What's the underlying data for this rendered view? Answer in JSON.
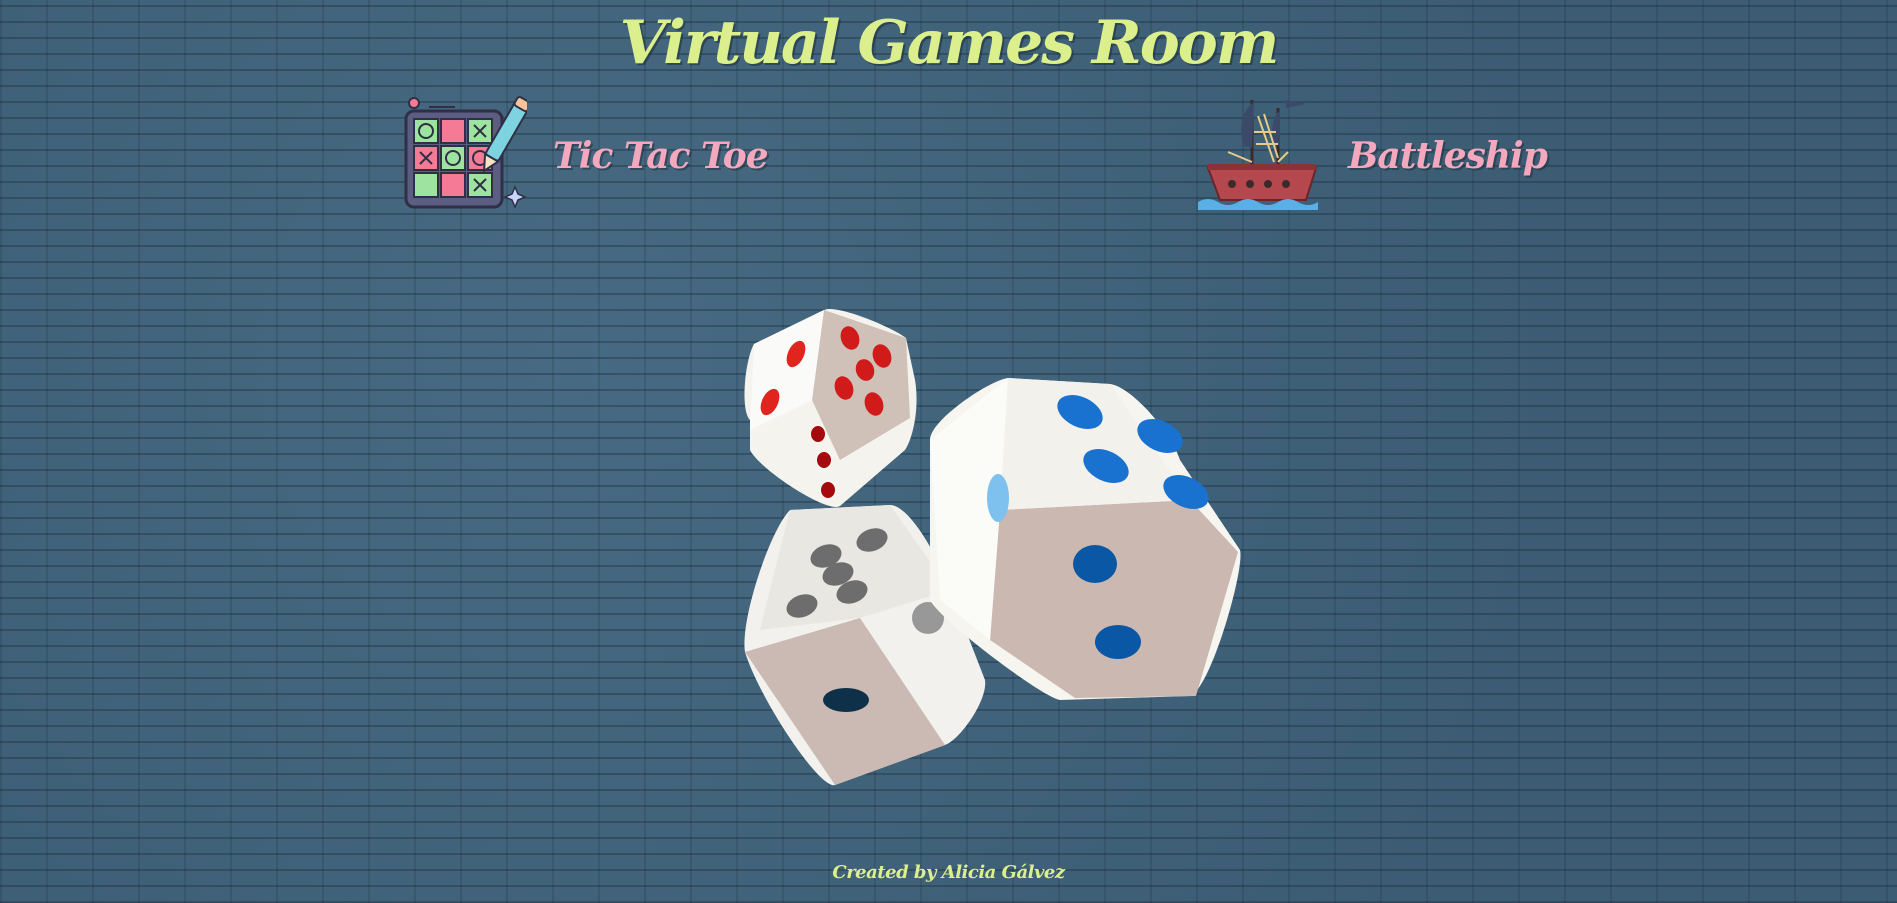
{
  "header": {
    "title": "Virtual Games Room"
  },
  "games": [
    {
      "label": "Tic Tac Toe",
      "icon": "tic-tac-toe-board-icon"
    },
    {
      "label": "Battleship",
      "icon": "pirate-ship-icon"
    }
  ],
  "hero": {
    "icon": "dice-icon"
  },
  "footer": {
    "credit": "Created by Alicia Gálvez"
  },
  "colors": {
    "background": "#3f6178",
    "title": "#dbf08c",
    "game_label": "#f4a8bd",
    "footer": "#dbf08c"
  }
}
